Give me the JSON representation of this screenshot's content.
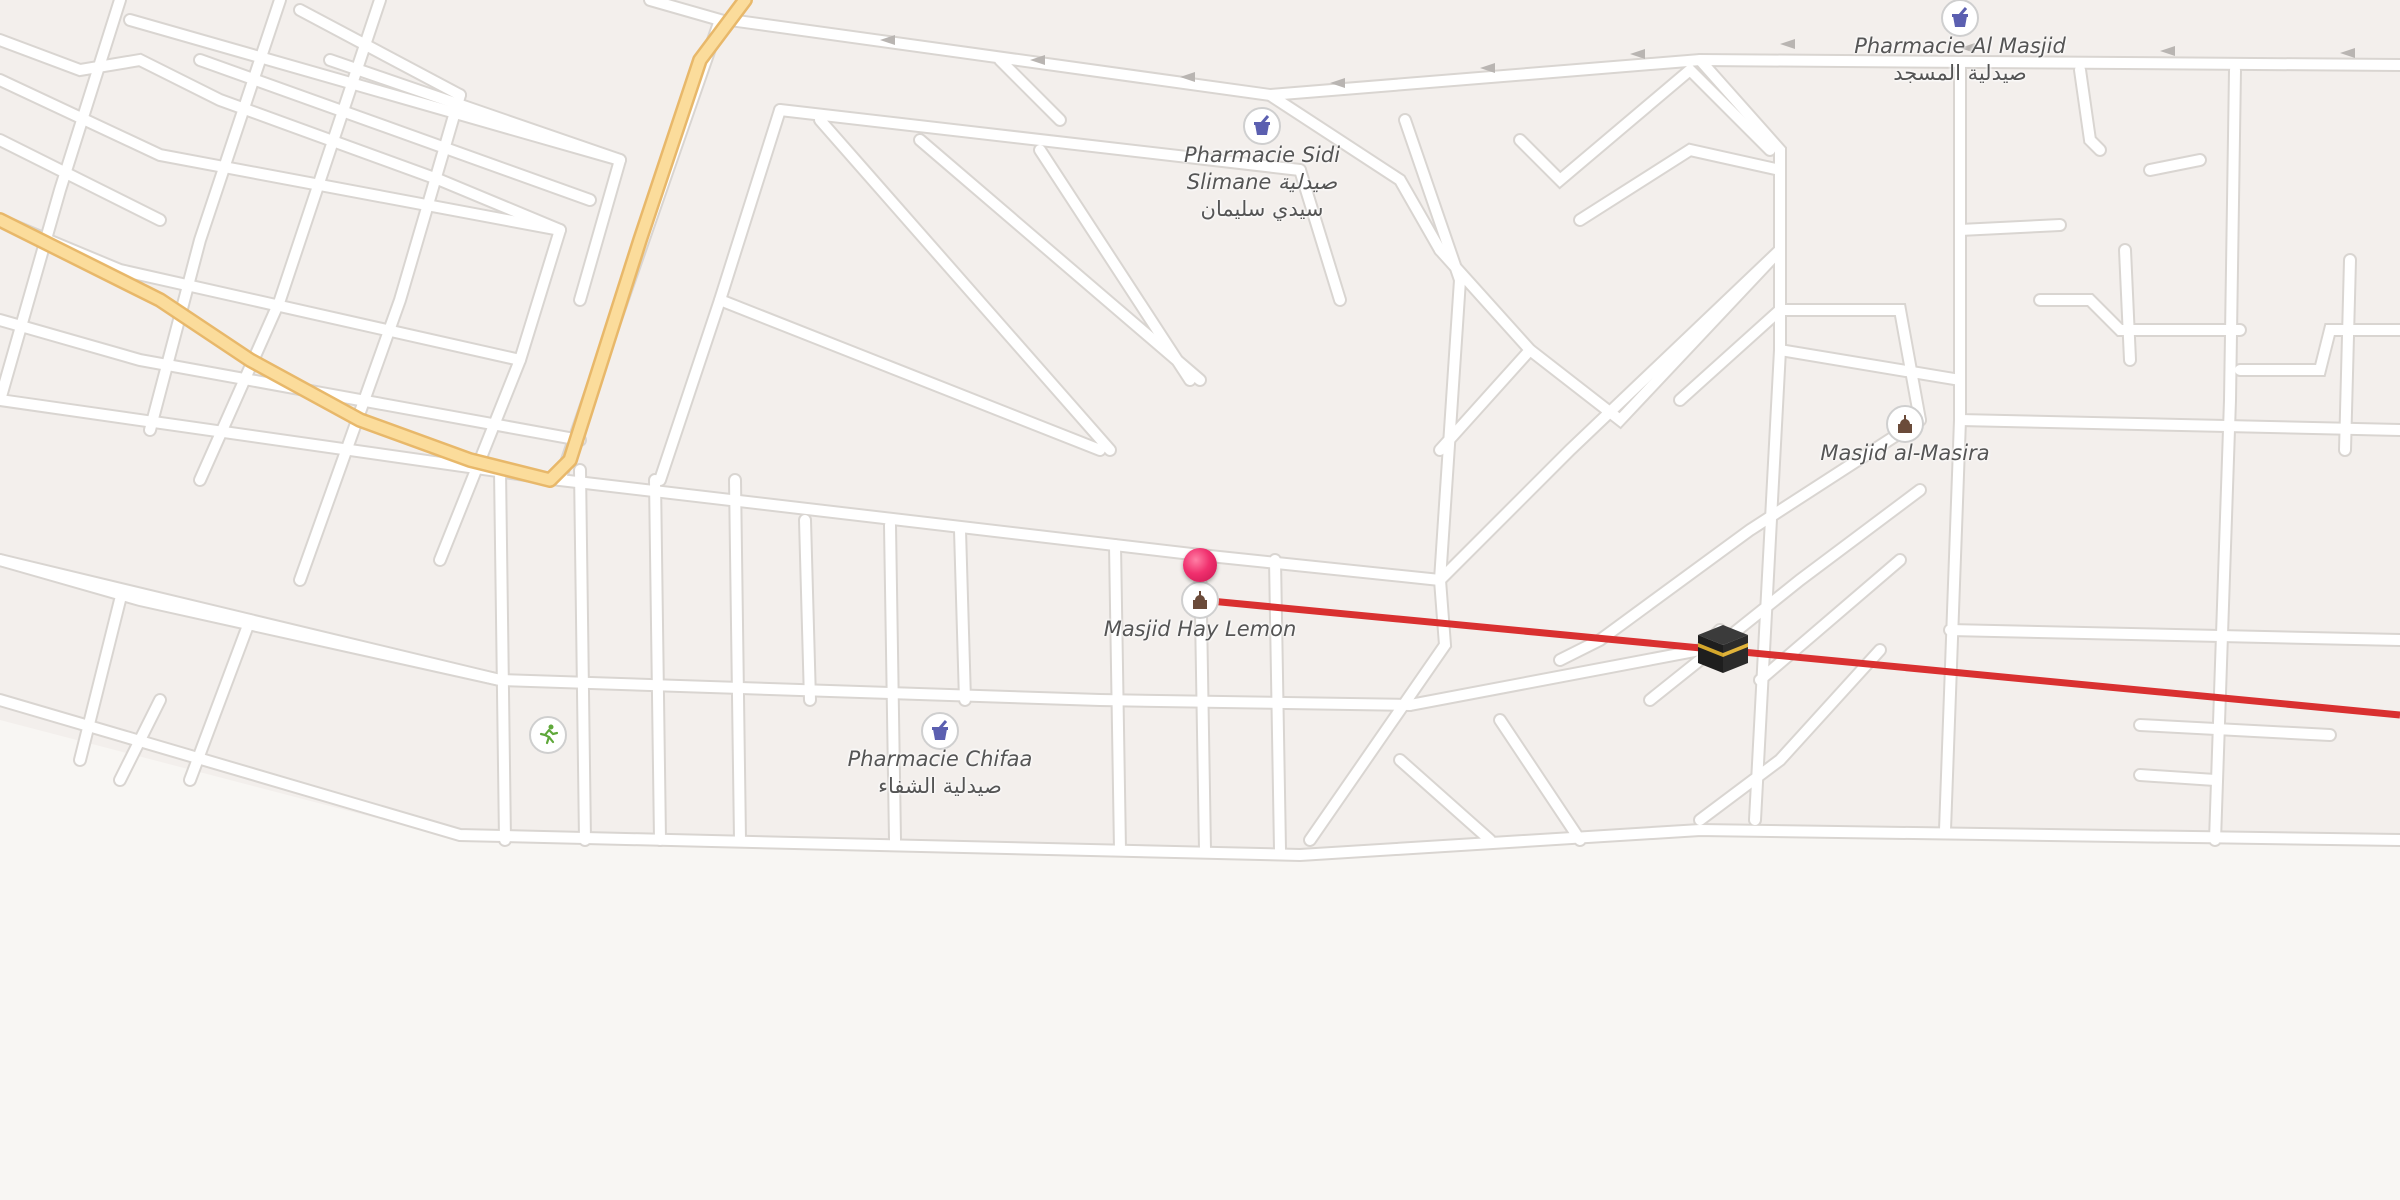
{
  "map": {
    "background": "#f8f6f3",
    "block_color": "#f3efec",
    "road_color": "#ffffff",
    "road_edge_color": "#d9d5d1",
    "main_road_color": "#fbdc9b",
    "main_road_edge_color": "#e8b86a",
    "qibla_line_color": "#d93030",
    "marker_color": "#f0306e"
  },
  "places": [
    {
      "id": "pharmacie-al-masjid",
      "name": "Pharmacie Al Masjid",
      "name_ar": "صيدلية المسجد",
      "icon": "pharmacy-icon"
    },
    {
      "id": "pharmacie-sidi-slimane",
      "name": "Pharmacie Sidi Slimane صيدلية",
      "name_ar": "سيدي سليمان",
      "icon": "pharmacy-icon"
    },
    {
      "id": "masjid-al-masira",
      "name": "Masjid al-Masira",
      "icon": "mosque-icon"
    },
    {
      "id": "masjid-hay-lemon",
      "name": "Masjid Hay Lemon",
      "icon": "mosque-icon"
    },
    {
      "id": "pharmacie-chifaa",
      "name": "Pharmacie Chifaa",
      "name_ar": "صيدلية الشفاء",
      "icon": "pharmacy-icon"
    },
    {
      "id": "sports-place",
      "icon": "running-person-icon"
    }
  ],
  "markers": {
    "location_pin": "location-pin-icon",
    "qibla_target": "kaaba-icon"
  }
}
